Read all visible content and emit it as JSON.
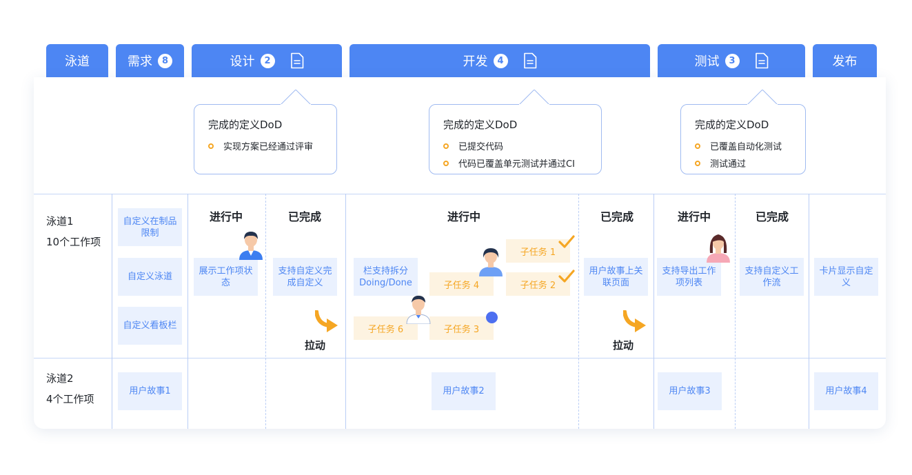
{
  "headers": {
    "lane": "泳道",
    "requirement": {
      "label": "需求",
      "count": "8"
    },
    "design": {
      "label": "设计",
      "count": "2"
    },
    "dev": {
      "label": "开发",
      "count": "4"
    },
    "test": {
      "label": "测试",
      "count": "3"
    },
    "release": "发布"
  },
  "dod": {
    "design": {
      "title": "完成的定义DoD",
      "items": [
        "实现方案已经通过评审"
      ]
    },
    "dev": {
      "title": "完成的定义DoD",
      "items": [
        "已提交代码",
        "代码已覆盖单元测试并通过CI"
      ]
    },
    "test": {
      "title": "完成的定义DoD",
      "items": [
        "已覆盖自动化测试",
        "测试通过"
      ]
    }
  },
  "lanes": [
    {
      "name": "泳道1",
      "count": "10个工作项"
    },
    {
      "name": "泳道2",
      "count": "4个工作项"
    }
  ],
  "columns": {
    "design_doing": "进行中",
    "design_done": "已完成",
    "dev_doing": "进行中",
    "dev_done": "已完成",
    "test_doing": "进行中",
    "test_done": "已完成"
  },
  "lane1_cards": {
    "req1": "自定义在制品限制",
    "req2": "自定义泳道",
    "req3": "自定义看板栏",
    "design_doing": "展示工作项状态",
    "design_done": "支持自定义完成自定义",
    "dev_doing": "栏支持拆分Doing/Done",
    "dev_done": "用户故事上关联页面",
    "test_doing": "支持导出工作项列表",
    "test_done": "支持自定义工作流",
    "release": "卡片显示自定义"
  },
  "subtasks": {
    "s1": "子任务 1",
    "s2": "子任务 2",
    "s3": "子任务 3",
    "s4": "子任务 4",
    "s6": "子任务 6"
  },
  "pull_labels": [
    "拉动",
    "拉动"
  ],
  "lane2_cards": [
    "用户故事1",
    "用户故事2",
    "用户故事3",
    "用户故事4"
  ],
  "colors": {
    "accent": "#4d86f3",
    "subtask": "#f5a623",
    "card_bg": "#eaf1fe"
  }
}
